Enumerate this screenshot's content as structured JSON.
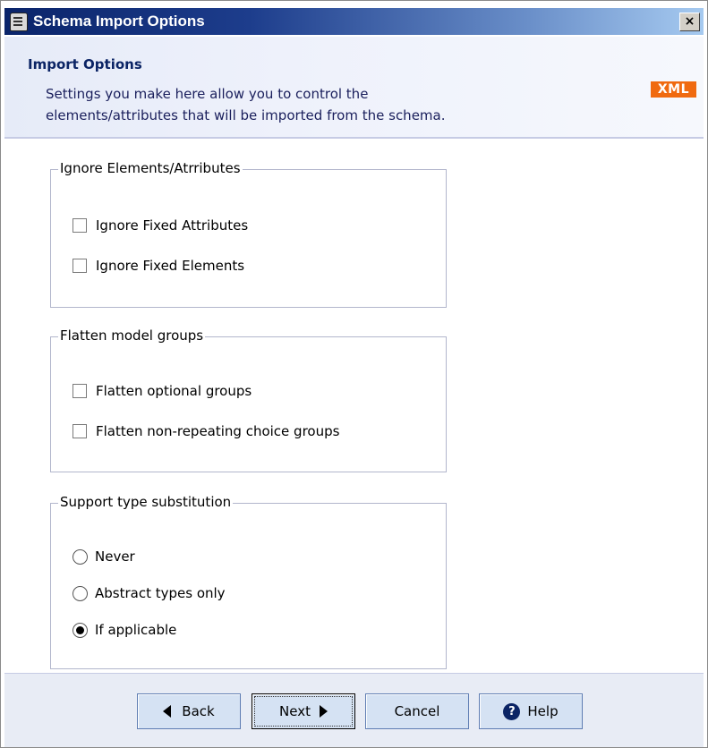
{
  "window": {
    "title": "Schema Import Options",
    "close_label": "×"
  },
  "header": {
    "title": "Import Options",
    "description_line1": "Settings you make here allow you to control the",
    "description_line2": "elements/attributes that will be imported from the schema.",
    "badge": "XML"
  },
  "groups": {
    "ignore": {
      "title": "Ignore Elements/Atrributes",
      "items": [
        {
          "label": "Ignore Fixed Attributes",
          "checked": false
        },
        {
          "label": "Ignore Fixed Elements",
          "checked": false
        }
      ]
    },
    "flatten": {
      "title": "Flatten model groups",
      "items": [
        {
          "label": "Flatten optional groups",
          "checked": false
        },
        {
          "label": "Flatten non-repeating choice groups",
          "checked": false
        }
      ]
    },
    "substitution": {
      "title": "Support type substitution",
      "options": [
        {
          "label": "Never",
          "selected": false
        },
        {
          "label": "Abstract types only",
          "selected": false
        },
        {
          "label": "If applicable",
          "selected": true
        }
      ]
    }
  },
  "buttons": {
    "back": "Back",
    "next": "Next",
    "cancel": "Cancel",
    "help": "Help"
  },
  "colors": {
    "titlebar_start": "#0a246a",
    "badge": "#f06a10",
    "header_text": "#0b2465"
  }
}
